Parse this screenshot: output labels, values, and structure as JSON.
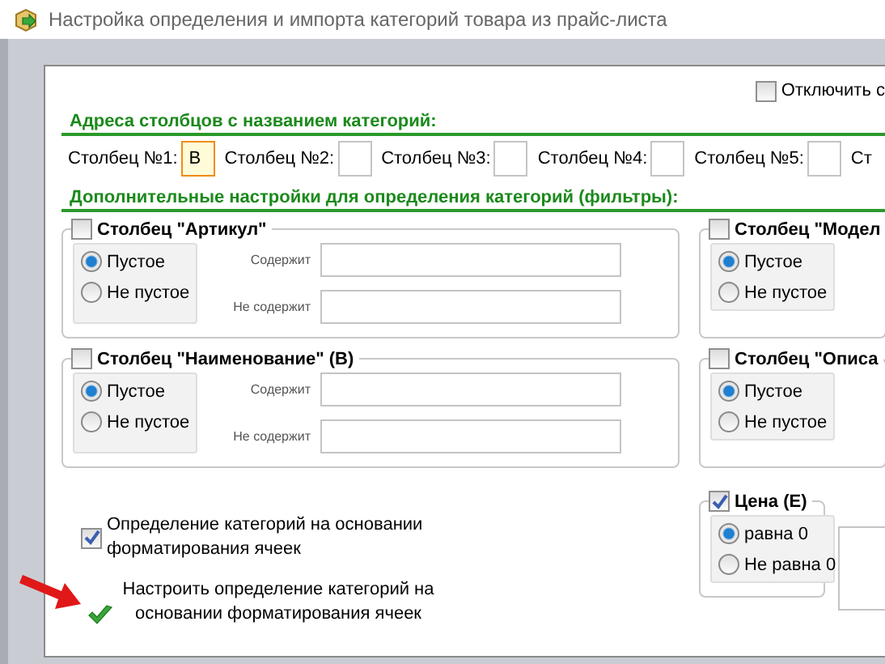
{
  "window": {
    "title": "Настройка определения и импорта категорий товара из прайс-листа"
  },
  "disable_option": {
    "label": "Отключить с",
    "checked": false
  },
  "address_header": "Адреса столбцов с названием категорий:",
  "columns": [
    {
      "label": "Столбец №1:",
      "value": "B",
      "focused": true
    },
    {
      "label": "Столбец №2:",
      "focused": false
    },
    {
      "label": "Столбец №3:",
      "focused": false
    },
    {
      "label": "Столбец №4:",
      "focused": false
    },
    {
      "label": "Столбец №5:",
      "focused": false
    }
  ],
  "column_6_label": "Ст",
  "filters_header": "Дополнительные настройки для определения категорий (фильтры):",
  "left_groups": [
    {
      "title": "Столбец \"Артикул\"",
      "checked": false,
      "options": [
        {
          "label": "Пустое",
          "selected": true
        },
        {
          "label": "Не пустое",
          "selected": false
        }
      ],
      "contains_label": "Содержит",
      "not_contains_label": "Не содержит"
    },
    {
      "title": "Столбец \"Наименование\" (B)",
      "checked": false,
      "options": [
        {
          "label": "Пустое",
          "selected": true
        },
        {
          "label": "Не пустое",
          "selected": false
        }
      ],
      "contains_label": "Содержит",
      "not_contains_label": "Не содержит"
    }
  ],
  "right_groups": [
    {
      "title": "Столбец \"Модел",
      "checked": false,
      "options": [
        {
          "label": "Пустое",
          "selected": true
        },
        {
          "label": "Не пустое",
          "selected": false
        }
      ]
    },
    {
      "title": "Столбец \"Описа",
      "checked": false,
      "options": [
        {
          "label": "Пустое",
          "selected": true
        },
        {
          "label": "Не пустое",
          "selected": false
        }
      ]
    }
  ],
  "price_group": {
    "title": "Цена (E)",
    "checked": true,
    "options": [
      {
        "label": "равна 0",
        "selected": true
      },
      {
        "label": "Не равна 0",
        "selected": false
      }
    ]
  },
  "format_option": {
    "label": "Определение категорий на основании форматирования ячеек",
    "checked": true
  },
  "configure_link": "Настроить определение категорий на основании форматирования ячеек"
}
